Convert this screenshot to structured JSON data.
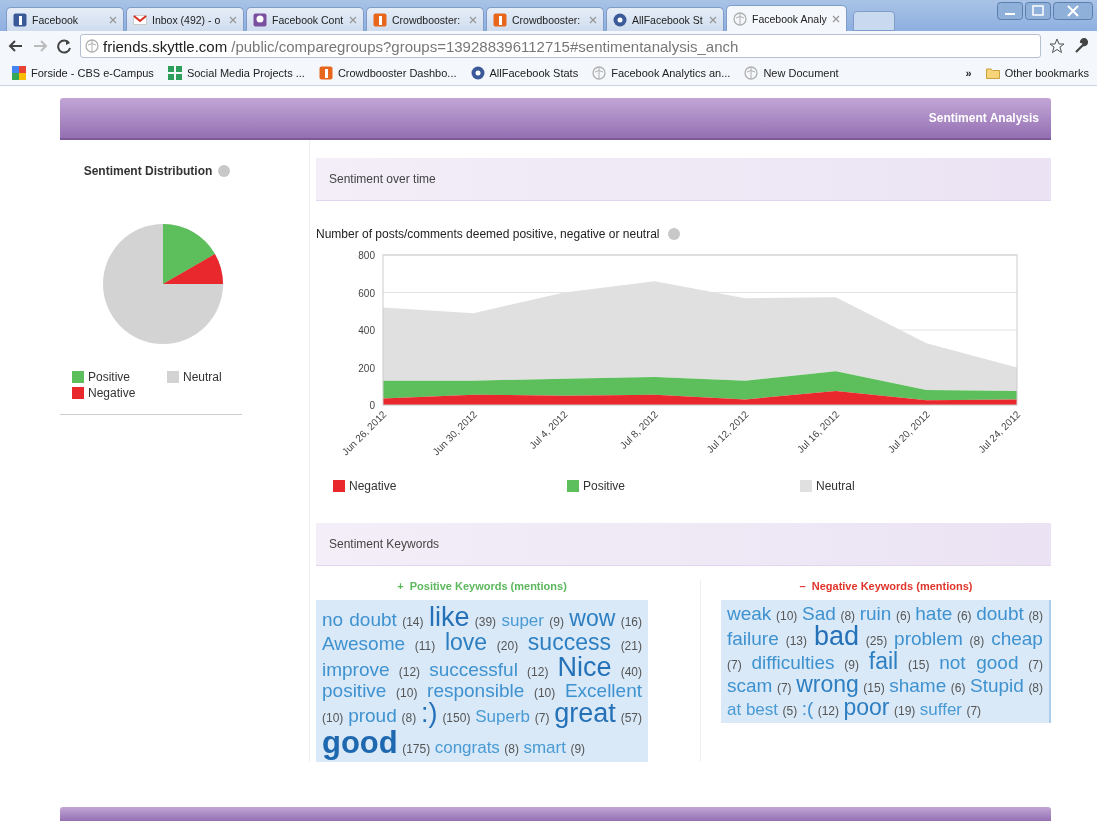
{
  "browser": {
    "tabs": [
      {
        "label": "Facebook",
        "kind": "fb",
        "selected": false
      },
      {
        "label": "Inbox (492) - o",
        "kind": "mail",
        "selected": false
      },
      {
        "label": "Facebook Cont",
        "kind": "chat",
        "selected": false
      },
      {
        "label": "Crowdbooster:",
        "kind": "orange",
        "selected": false
      },
      {
        "label": "Crowdbooster:",
        "kind": "orange",
        "selected": false
      },
      {
        "label": "AllFacebook St",
        "kind": "af",
        "selected": false
      },
      {
        "label": "Facebook Analy",
        "kind": "globe",
        "selected": true
      }
    ],
    "url_host": "friends.skyttle.com",
    "url_path": "/public/comparegroups?groups=139288396112715#sentimentanalysis_anch",
    "bookmarks": [
      {
        "label": "Forside - CBS e-Campus",
        "kind": "google"
      },
      {
        "label": "Social Media Projects ...",
        "kind": "grid"
      },
      {
        "label": "Crowdbooster Dashbo...",
        "kind": "orange"
      },
      {
        "label": "AllFacebook Stats",
        "kind": "af"
      },
      {
        "label": "Facebook Analytics an...",
        "kind": "globe"
      },
      {
        "label": "New Document",
        "kind": "globe"
      }
    ],
    "more": "»",
    "other_bookmarks": "Other bookmarks"
  },
  "section_title": "Sentiment Analysis",
  "distribution": {
    "title": "Sentiment Distribution",
    "legend": [
      {
        "label": "Positive",
        "color": "#5cbf5c"
      },
      {
        "label": "Neutral",
        "color": "#d3d3d3"
      },
      {
        "label": "Negative",
        "color": "#e8282c"
      }
    ]
  },
  "over_time": {
    "title": "Sentiment over time",
    "chart_title": "Number of posts/comments deemed positive, negative or neutral",
    "chart_data": {
      "type": "area",
      "stacked": true,
      "categories": [
        "Jun 26, 2012",
        "Jun 30, 2012",
        "Jul 4, 2012",
        "Jul 8, 2012",
        "Jul 12, 2012",
        "Jul 16, 2012",
        "Jul 20, 2012",
        "Jul 24, 2012"
      ],
      "ylim": [
        0,
        800
      ],
      "grid": true,
      "legend": "bottom",
      "yticks": [
        0,
        200,
        400,
        600,
        800
      ],
      "series": [
        {
          "name": "Negative",
          "color": "#e8282c",
          "values": [
            35,
            55,
            50,
            55,
            30,
            75,
            25,
            30
          ]
        },
        {
          "name": "Positive",
          "color": "#5cbf5c",
          "values": [
            95,
            75,
            90,
            95,
            100,
            105,
            55,
            45
          ]
        },
        {
          "name": "Neutral",
          "color": "#e0e0e0",
          "values": [
            390,
            360,
            460,
            510,
            440,
            395,
            250,
            125
          ]
        }
      ]
    }
  },
  "keywords": {
    "title": "Sentiment Keywords",
    "positive": {
      "title": "Positive Keywords (mentions)",
      "sign": "+",
      "items": [
        {
          "word": "no doubt",
          "count": "(14)",
          "kind": "m"
        },
        {
          "word": "like",
          "count": "(39)",
          "kind": "xl"
        },
        {
          "word": "super",
          "count": "(9)",
          "kind": "s"
        },
        {
          "word": "wow",
          "count": "(16)",
          "kind": "l"
        },
        {
          "word": "Awesome",
          "count": "(11)",
          "kind": "m"
        },
        {
          "word": "love",
          "count": "(20)",
          "kind": "l"
        },
        {
          "word": "success",
          "count": "(21)",
          "kind": "l"
        },
        {
          "word": "improve",
          "count": "(12)",
          "kind": "m"
        },
        {
          "word": "successful",
          "count": "(12)",
          "kind": "m"
        },
        {
          "word": "Nice",
          "count": "(40)",
          "kind": "xl"
        },
        {
          "word": "positive",
          "count": "(10)",
          "kind": "m"
        },
        {
          "word": "responsible",
          "count": "(10)",
          "kind": "m"
        },
        {
          "word": "Excellent",
          "count": "(10)",
          "kind": "m"
        },
        {
          "word": "proud",
          "count": "(8)",
          "kind": "m"
        },
        {
          "word": ":)",
          "count": "(150)",
          "kind": "xl"
        },
        {
          "word": "Superb",
          "count": "(7)",
          "kind": "s"
        },
        {
          "word": "great",
          "count": "(57)",
          "kind": "xl"
        },
        {
          "word": "good",
          "count": "(175)",
          "kind": "xxl"
        },
        {
          "word": "congrats",
          "count": "(8)",
          "kind": "s"
        },
        {
          "word": "smart",
          "count": "(9)",
          "kind": "s"
        }
      ]
    },
    "negative": {
      "title": "Negative Keywords (mentions)",
      "sign": "–",
      "items": [
        {
          "word": "weak",
          "count": "(10)",
          "kind": "m"
        },
        {
          "word": "Sad",
          "count": "(8)",
          "kind": "m"
        },
        {
          "word": "ruin",
          "count": "(6)",
          "kind": "m"
        },
        {
          "word": "hate",
          "count": "(6)",
          "kind": "m"
        },
        {
          "word": "doubt",
          "count": "(8)",
          "kind": "m"
        },
        {
          "word": "failure",
          "count": "(13)",
          "kind": "m"
        },
        {
          "word": "bad",
          "count": "(25)",
          "kind": "xl"
        },
        {
          "word": "problem",
          "count": "(8)",
          "kind": "m"
        },
        {
          "word": "cheap",
          "count": "(7)",
          "kind": "m"
        },
        {
          "word": "difficulties",
          "count": "(9)",
          "kind": "m"
        },
        {
          "word": "fail",
          "count": "(15)",
          "kind": "l"
        },
        {
          "word": "not good",
          "count": "(7)",
          "kind": "m"
        },
        {
          "word": "scam",
          "count": "(7)",
          "kind": "m"
        },
        {
          "word": "wrong",
          "count": "(15)",
          "kind": "l"
        },
        {
          "word": "shame",
          "count": "(6)",
          "kind": "m"
        },
        {
          "word": "Stupid",
          "count": "(8)",
          "kind": "m"
        },
        {
          "word": "at best",
          "count": "(5)",
          "kind": "s"
        },
        {
          "word": ":(",
          "count": "(12)",
          "kind": "m"
        },
        {
          "word": "poor",
          "count": "(19)",
          "kind": "l"
        },
        {
          "word": "suffer",
          "count": "(7)",
          "kind": "s"
        }
      ]
    }
  }
}
